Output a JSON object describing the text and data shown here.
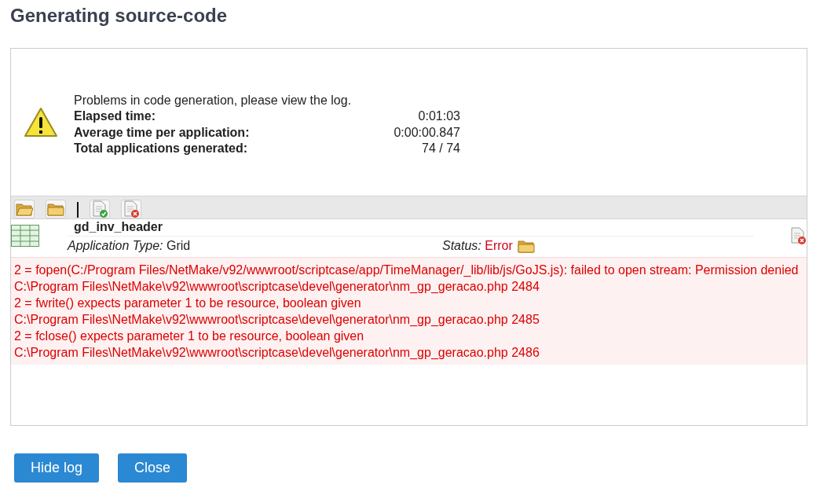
{
  "title": "Generating source-code",
  "summary": {
    "message": "Problems in code generation, please view the log.",
    "stats": [
      {
        "label": "Elapsed time:",
        "value": "0:01:03"
      },
      {
        "label": "Average time per application:",
        "value": "0:00:00.847"
      },
      {
        "label": "Total applications generated:",
        "value": "74 / 74"
      }
    ]
  },
  "toolbar": [
    {
      "kind": "open-folder"
    },
    {
      "kind": "folder"
    },
    {
      "kind": "separator"
    },
    {
      "kind": "doc-ok"
    },
    {
      "kind": "doc-error"
    }
  ],
  "application": {
    "name": "gd_inv_header",
    "type_label": "Application Type:",
    "type": "Grid",
    "status_label": "Status:",
    "status": "Error",
    "log": [
      "2 = fopen(C:/Program Files/NetMake/v92/wwwroot/scriptcase/app/TimeManager/_lib/lib/js/GoJS.js): failed to open stream: Permission denied",
      "C:\\Program Files\\NetMake\\v92\\wwwroot\\scriptcase\\devel\\generator\\nm_gp_geracao.php 2484",
      "2 = fwrite() expects parameter 1 to be resource, boolean given",
      "C:\\Program Files\\NetMake\\v92\\wwwroot\\scriptcase\\devel\\generator\\nm_gp_geracao.php 2485",
      "2 = fclose() expects parameter 1 to be resource, boolean given",
      "C:\\Program Files\\NetMake\\v92\\wwwroot\\scriptcase\\devel\\generator\\nm_gp_geracao.php 2486"
    ]
  },
  "buttons": [
    "Hide log",
    "Close"
  ]
}
